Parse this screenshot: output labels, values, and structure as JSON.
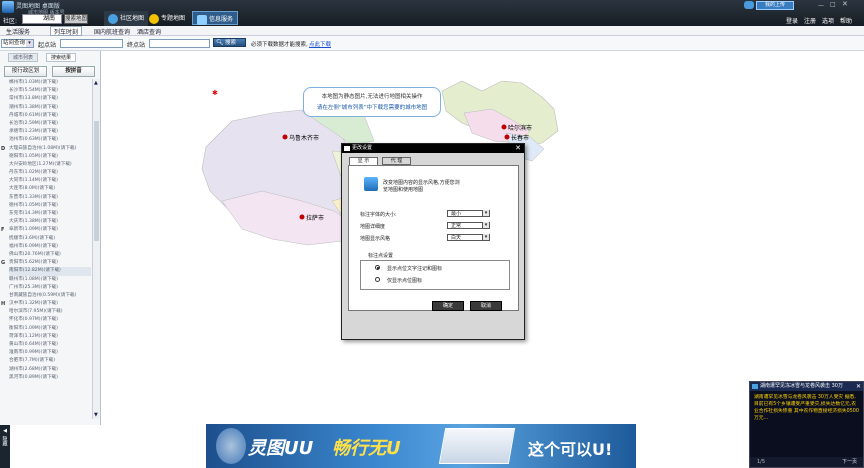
{
  "titlebar": {
    "title": "灵图地图 桌面版",
    "subtitle": "城市地图 版本号",
    "city_label": "社区:",
    "city_input": "湖南",
    "button_search": "搜索地图",
    "nav": [
      {
        "label": "社区地图",
        "icon": "globe-icon"
      },
      {
        "label": "专题地图",
        "icon": "smile-icon"
      },
      {
        "label": "信息服务",
        "icon": "info-icon"
      }
    ],
    "right": {
      "sync": "我的上传",
      "links": [
        "登录",
        "注册",
        "选项",
        "帮助"
      ]
    }
  },
  "toolbar2": {
    "items": [
      "生活服务",
      "列车时刻",
      "国内航班查询",
      "酒店查询"
    ]
  },
  "toolbar3": {
    "mode": "站间查询",
    "start_label": "起点站",
    "end_label": "终点站",
    "search_btn": "搜索",
    "note": "必须下载数据才能搜索,",
    "link": "点此下载"
  },
  "sidebar": {
    "tabs": [
      "城市列表",
      "搜索结果"
    ],
    "btn_admin": "按行政区划",
    "btn_pinyin": "按拼音",
    "items": [
      {
        "letter": "",
        "text": "郴州市(1.03M)(请下载)"
      },
      {
        "letter": "",
        "text": "长沙市(5.54M)(请下载)"
      },
      {
        "letter": "",
        "text": "常州市(13.8M)(请下载)"
      },
      {
        "letter": "",
        "text": "潮州市(1.38M)(请下载)"
      },
      {
        "letter": "",
        "text": "丹城市(0.61M)(请下载)"
      },
      {
        "letter": "",
        "text": "长治市(2.59M)(请下载)"
      },
      {
        "letter": "",
        "text": "承德市(1.23M)(请下载)"
      },
      {
        "letter": "",
        "text": "池州市(0.63M)(请下载)"
      },
      {
        "letter": "D",
        "text": "大理白族自治州(1.08M)(请下载)"
      },
      {
        "letter": "",
        "text": "德阳市(1.05M)(请下载)"
      },
      {
        "letter": "",
        "text": "大兴安岭地区(1.27M)(请下载)"
      },
      {
        "letter": "",
        "text": "丹东市(1.02M)(请下载)"
      },
      {
        "letter": "",
        "text": "大同市(1.14M)(请下载)"
      },
      {
        "letter": "",
        "text": "大连市(8.0M)(请下载)"
      },
      {
        "letter": "",
        "text": "东营市(1.33M)(请下载)"
      },
      {
        "letter": "",
        "text": "德州市(1.05M)(请下载)"
      },
      {
        "letter": "",
        "text": "东莞市(14.3M)(请下载)"
      },
      {
        "letter": "",
        "text": "大庆市(1.38M)(请下载)"
      },
      {
        "letter": "F",
        "text": "阜新市(1.09M)(请下载)"
      },
      {
        "letter": "",
        "text": "抚顺市(3.6M)(请下载)"
      },
      {
        "letter": "",
        "text": "福州市(6.09M)(请下载)"
      },
      {
        "letter": "",
        "text": "佛山市(20.76M)(请下载)"
      },
      {
        "letter": "G",
        "text": "贵阳市(5.62M)(请下载)"
      },
      {
        "letter": "",
        "text": "南阳市(12.82M)(请下载)"
      },
      {
        "letter": "",
        "text": "赣州市(1.08M)(请下载)"
      },
      {
        "letter": "",
        "text": "广州市(25.3M)(请下载)"
      },
      {
        "letter": "",
        "text": "甘南藏族自治州(0.59M)(请下载)"
      },
      {
        "letter": "H",
        "text": "汉中市(1.32M)(请下载)"
      },
      {
        "letter": "",
        "text": "哈尔滨市(7.95M)(请下载)"
      },
      {
        "letter": "",
        "text": "怀化市(0.97M)(请下载)"
      },
      {
        "letter": "",
        "text": "衡阳市(1.09M)(请下载)"
      },
      {
        "letter": "",
        "text": "菏泽市(1.12M)(请下载)"
      },
      {
        "letter": "",
        "text": "黄山市(0.64M)(请下载)"
      },
      {
        "letter": "",
        "text": "淮南市(0.99M)(请下载)"
      },
      {
        "letter": "",
        "text": "合肥市(7.7M)(请下载)"
      },
      {
        "letter": "",
        "text": "湖州市(2.68M)(请下载)"
      },
      {
        "letter": "",
        "text": "黑河市(0.89M)(请下载)"
      }
    ]
  },
  "map": {
    "notice_line1": "本地图为静态图片,无法进行地图相关操作",
    "notice_line2": "请在左侧“城市列表”中下载您需要的城市地图",
    "cities": [
      "乌鲁木齐市",
      "拉萨市",
      "哈尔滨市",
      "长春市"
    ]
  },
  "dialog": {
    "title": "更改设置",
    "tabs": [
      "显 示",
      "代 理"
    ],
    "desc": "改变地图内容的显示风格,方便您浏览地图和使用地图",
    "rows": [
      {
        "label": "标注字体的大小:",
        "value": "最小"
      },
      {
        "label": "地图详细度",
        "value": "正常"
      },
      {
        "label": "地图显示风格",
        "value": "白天"
      }
    ],
    "group_title": "标注点设置",
    "opt1": "显示点位文字注记和图标",
    "opt2": "仅显示点位图标",
    "ok": "确定",
    "cancel": "取消"
  },
  "news": {
    "title": "湖南遭罕见冻冰雪与龙卷风袭击 30万",
    "body": "湖南遭罕见冰雪与龙卷风袭击 30万人受灾 据悉,目前已有5个乡镇遭受严重受灾,损失达数亿元,农业合作社损失惨重 其中农作物直接经济损失0500万元...",
    "page": "1/5",
    "next": "下一页"
  },
  "banner": {
    "brand": "灵图UU",
    "slogan": "畅行无U",
    "tagline": "这个可以U!"
  },
  "leftstrip": {
    "text": "隐藏"
  }
}
